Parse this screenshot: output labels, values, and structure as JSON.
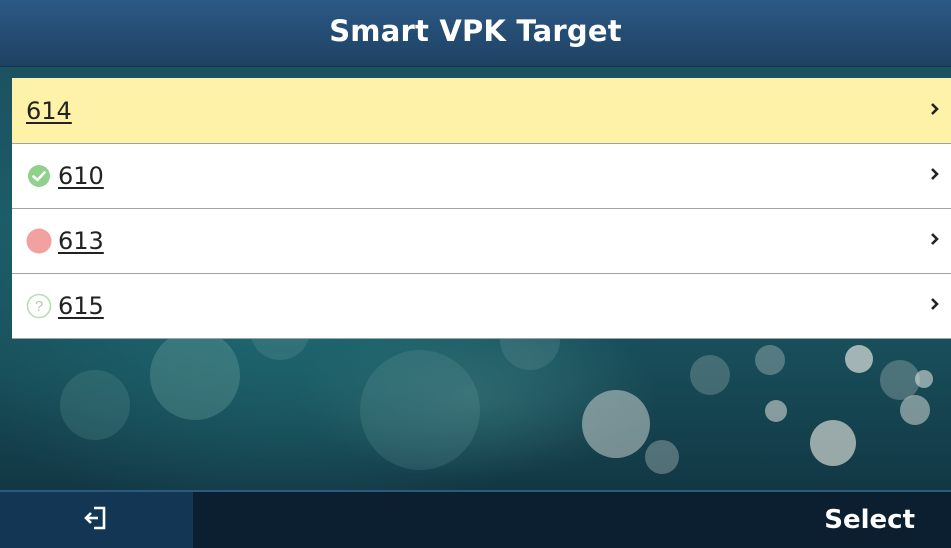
{
  "header": {
    "title": "Smart VPK Target"
  },
  "targets": [
    {
      "label": "614",
      "status": "none",
      "selected": true
    },
    {
      "label": "610",
      "status": "available-check-icon"
    },
    {
      "label": "613",
      "status": "busy-dot-icon"
    },
    {
      "label": "615",
      "status": "unknown-question-icon"
    }
  ],
  "softkeys": {
    "back_icon": "exit-icon",
    "select_label": "Select"
  },
  "colors": {
    "titlebar": "#234a70",
    "selected_row": "#fdf2a8",
    "available": "#7fcf7f",
    "busy": "#f19a9a"
  }
}
